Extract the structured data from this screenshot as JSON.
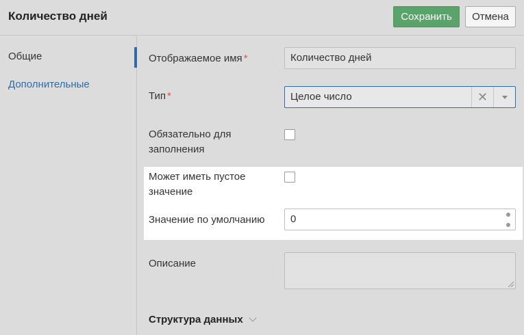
{
  "header": {
    "title": "Количество дней",
    "save_label": "Сохранить",
    "cancel_label": "Отмена"
  },
  "sidebar": {
    "items": [
      {
        "label": "Общие",
        "active": true
      },
      {
        "label": "Дополнительные",
        "active": false
      }
    ]
  },
  "form": {
    "display_name": {
      "label": "Отображаемое имя",
      "required_mark": "*",
      "value": "Количество дней"
    },
    "type": {
      "label": "Тип",
      "required_mark": "*",
      "value": "Целое число"
    },
    "required_fill": {
      "label_line1": "Обязательно для",
      "label_line2": "заполнения",
      "checked": false
    },
    "allow_empty": {
      "label_line1": "Может иметь пустое",
      "label_line2": "значение",
      "checked": false
    },
    "default_value": {
      "label": "Значение по умолчанию",
      "value": "0"
    },
    "description": {
      "label": "Описание",
      "value": ""
    },
    "data_structure": {
      "label": "Структура данных"
    }
  },
  "colors": {
    "accent": "#2f6ca6",
    "save_button": "#5aa36b",
    "required": "#d9534f"
  }
}
